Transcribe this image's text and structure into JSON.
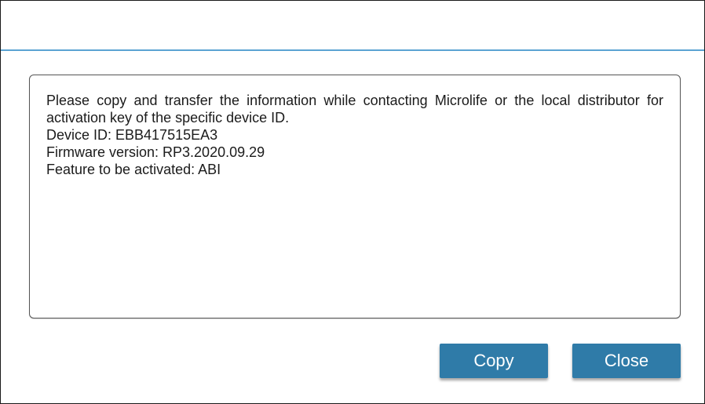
{
  "dialog": {
    "title": "",
    "info": {
      "message": "Please copy and transfer the information while contacting Microlife or the local distributor for activation key of the specific device ID.",
      "device_id": "Device ID: EBB417515EA3",
      "firmware_version": "Firmware version: RP3.2020.09.29",
      "feature": "Feature to be activated: ABI"
    },
    "buttons": {
      "copy_label": "Copy",
      "close_label": "Close"
    }
  },
  "colors": {
    "accent": "#2f7ba8",
    "divider": "#5ba3d3",
    "text": "#1b1b1b"
  }
}
